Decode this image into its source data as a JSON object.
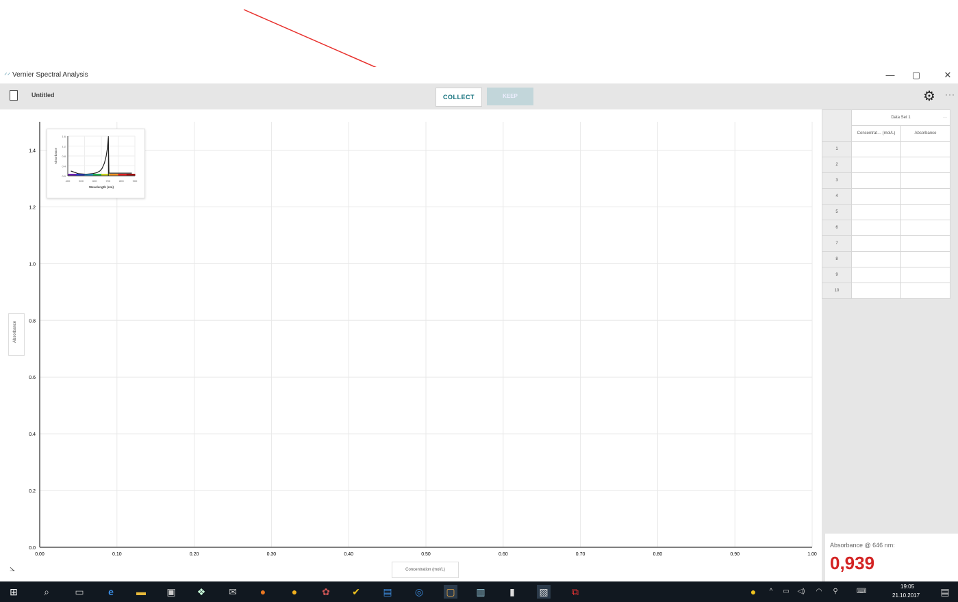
{
  "window": {
    "title": "Vernier Spectral Analysis",
    "minimize": "—",
    "maximize": "▢",
    "close": "✕"
  },
  "toolbar": {
    "file_name": "Untitled",
    "collect_label": "COLLECT",
    "keep_label": "KEEP",
    "more_label": "···"
  },
  "chart_data": [
    {
      "type": "scatter",
      "title": "",
      "xlabel": "Concentration (mol/L)",
      "ylabel": "Absorbance",
      "xlim": [
        0.0,
        1.0
      ],
      "ylim": [
        0.0,
        1.5
      ],
      "x_ticks": [
        "0.00",
        "0.10",
        "0.20",
        "0.30",
        "0.40",
        "0.50",
        "0.60",
        "0.70",
        "0.80",
        "0.90",
        "1.00"
      ],
      "y_ticks": [
        "0.0",
        "0.2",
        "0.4",
        "0.6",
        "0.8",
        "1.0",
        "1.2",
        "1.4"
      ],
      "grid": true,
      "series": []
    },
    {
      "type": "line",
      "xlabel": "Wavelength (nm)",
      "ylabel": "Absorbance",
      "xlim": [
        380,
        820
      ],
      "ylim": [
        0.0,
        1.5
      ],
      "x_ticks": [
        "400",
        "500",
        "600",
        "700",
        "800",
        "900"
      ],
      "y_ticks": [
        "0.0",
        "0.4",
        "0.8",
        "1.2",
        "1.6"
      ],
      "selected_wavelength": 646,
      "series": [
        {
          "x": [
            400,
            450,
            500,
            540,
            570,
            590,
            605,
            620,
            632,
            640,
            646,
            650,
            700,
            750,
            800
          ],
          "y": [
            0.18,
            0.08,
            0.06,
            0.08,
            0.12,
            0.18,
            0.28,
            0.48,
            0.75,
            1.05,
            1.45,
            0.1,
            0.1,
            0.1,
            0.1
          ]
        }
      ]
    }
  ],
  "table": {
    "dataset_title": "Data Set 1",
    "col1": "Concentrat… (mol/L)",
    "col2": "Absorbance",
    "dots": "···",
    "rows": [
      "1",
      "2",
      "3",
      "4",
      "5",
      "6",
      "7",
      "8",
      "9",
      "10"
    ]
  },
  "meter": {
    "label": "Absorbance @ 646 nm:",
    "value": "0,939"
  },
  "taskbar": {
    "time": "19:05",
    "date": "21.10.2017"
  },
  "colors": {
    "accent": "#0f6e7a",
    "meter_value": "#d32323",
    "arrow": "#e8322e"
  }
}
